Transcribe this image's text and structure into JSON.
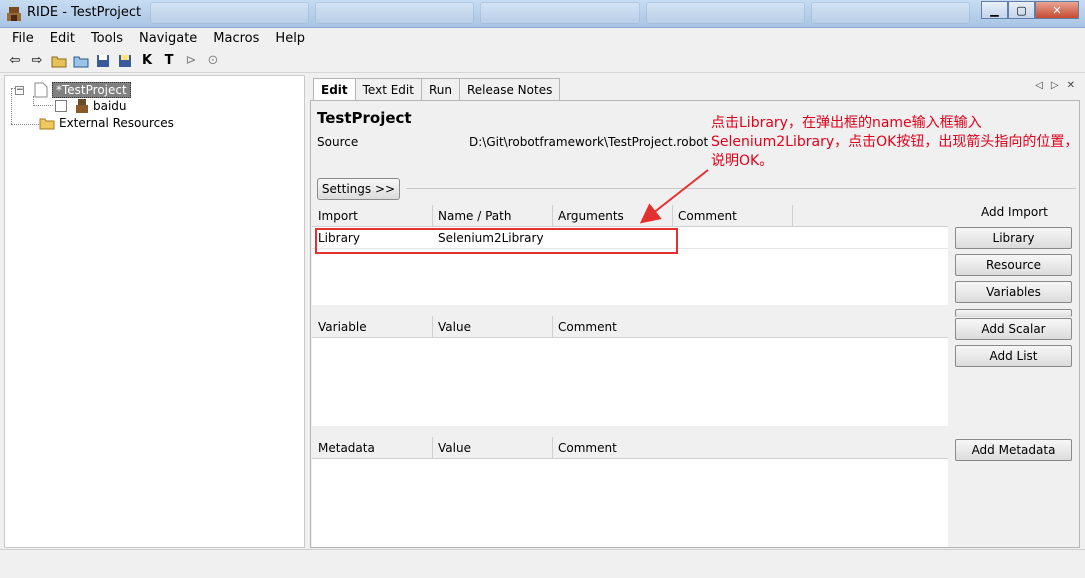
{
  "window": {
    "title": "RIDE - TestProject"
  },
  "menu": [
    "File",
    "Edit",
    "Tools",
    "Navigate",
    "Macros",
    "Help"
  ],
  "toolbar": {
    "k_label": "K",
    "t_label": "T"
  },
  "tree": {
    "root": "*TestProject",
    "child": "baidu",
    "external": "External Resources",
    "expander": "−"
  },
  "tabs": [
    "Edit",
    "Text Edit",
    "Run",
    "Release Notes"
  ],
  "editor": {
    "project_name": "TestProject",
    "source_label": "Source",
    "source_value": "D:\\Git\\robotframework\\TestProject.robot",
    "settings_button": "Settings >>",
    "import_table": {
      "headers": [
        "Import",
        "Name / Path",
        "Arguments",
        "Comment"
      ],
      "rows": [
        [
          "Library",
          "Selenium2Library",
          "",
          ""
        ]
      ]
    },
    "variable_table": {
      "headers": [
        "Variable",
        "Value",
        "Comment"
      ]
    },
    "metadata_table": {
      "headers": [
        "Metadata",
        "Value",
        "Comment"
      ]
    }
  },
  "side_buttons": {
    "add_import_label": "Add Import",
    "library": "Library",
    "resource": "Resource",
    "variables": "Variables",
    "add_scalar": "Add Scalar",
    "add_list": "Add List",
    "add_metadata": "Add Metadata"
  },
  "annotation": {
    "text": "点击Library，在弹出框的name输入框输入Selenium2Library，点击OK按钮，出现箭头指向的位置，说明OK。",
    "color": "#e0001a"
  }
}
